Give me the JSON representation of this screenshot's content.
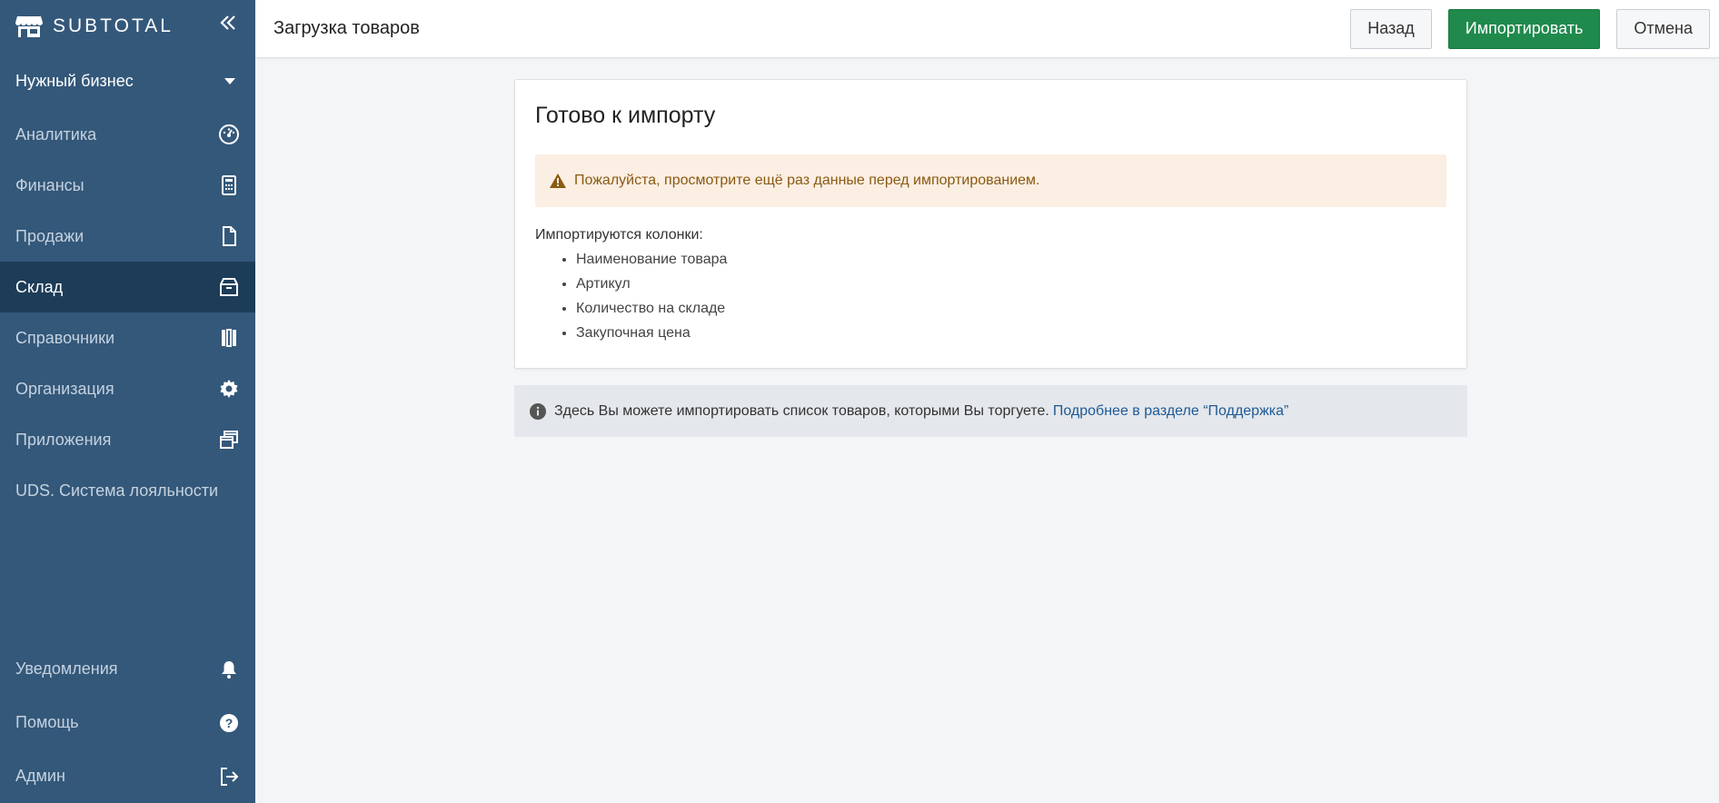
{
  "brand": {
    "name": "SUBTOTAL"
  },
  "business": {
    "name": "Нужный бизнес"
  },
  "nav": {
    "items": [
      {
        "label": "Аналитика",
        "icon": "dashboard-gauge-icon"
      },
      {
        "label": "Финансы",
        "icon": "calculator-icon"
      },
      {
        "label": "Продажи",
        "icon": "document-icon"
      },
      {
        "label": "Склад",
        "icon": "box-icon",
        "active": true
      },
      {
        "label": "Справочники",
        "icon": "books-icon"
      },
      {
        "label": "Организация",
        "icon": "gear-icon"
      },
      {
        "label": "Приложения",
        "icon": "windows-icon"
      },
      {
        "label": "UDS. Система лояльности",
        "icon": ""
      }
    ],
    "bottom": [
      {
        "label": "Уведомления",
        "icon": "bell-icon"
      },
      {
        "label": "Помощь",
        "icon": "question-icon"
      },
      {
        "label": "Админ",
        "icon": "logout-icon"
      }
    ]
  },
  "topbar": {
    "title": "Загрузка товаров",
    "back_label": "Назад",
    "import_label": "Импортировать",
    "cancel_label": "Отмена"
  },
  "card": {
    "title": "Готово к импорту",
    "warning": "Пожалуйста, просмотрите ещё раз данные перед импортированием.",
    "columns_label": "Импортируются колонки:",
    "columns": [
      "Наименование товара",
      "Артикул",
      "Количество на складе",
      "Закупочная цена"
    ]
  },
  "info": {
    "text": "Здесь Вы можете импортировать список товаров, которыми Вы торгуете.",
    "link": "Подробнее в разделе “Поддержка”"
  },
  "colors": {
    "sidebar": "#34587a",
    "sidebar_active": "#1d3c58",
    "primary": "#1f8a4c",
    "warning_bg": "#fbeee3",
    "warning_text": "#8a5a12",
    "link": "#1e5a96"
  }
}
